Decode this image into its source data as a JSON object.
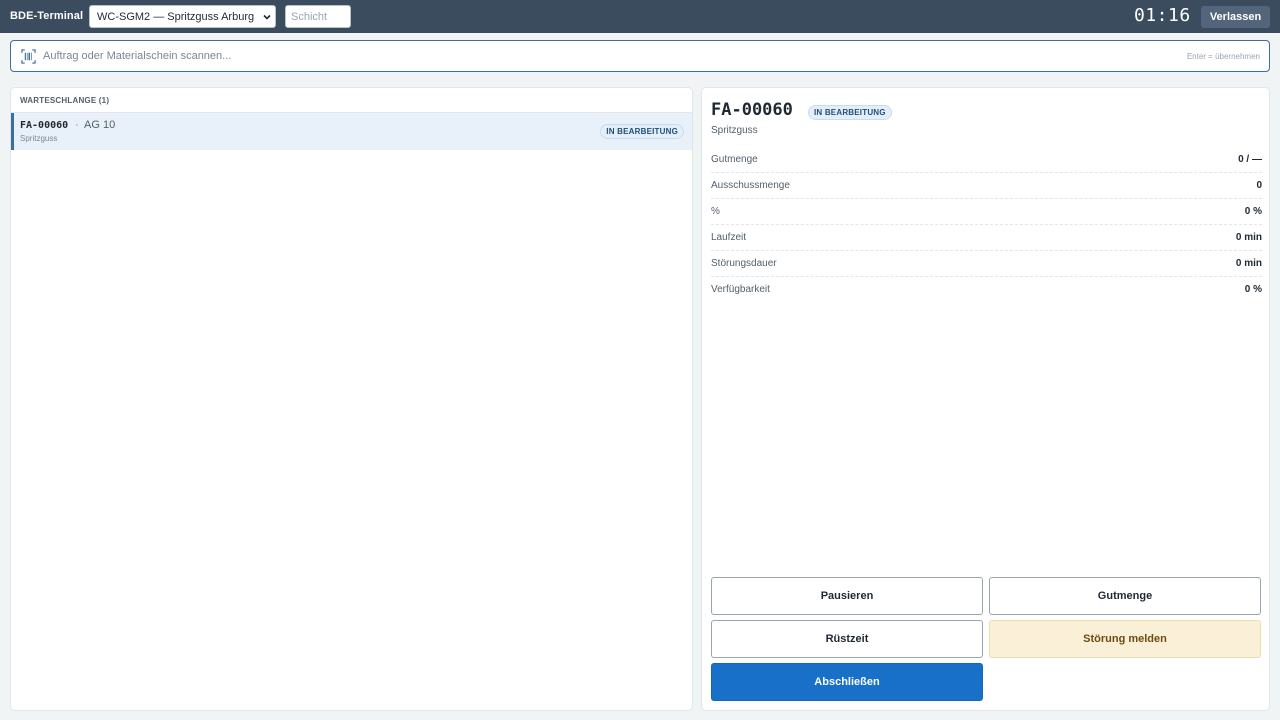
{
  "header": {
    "app_title": "BDE-Terminal",
    "workcenter_selected": "WC-SGM2 — Spritzguss Arburg",
    "shift_placeholder": "Schicht",
    "clock": "01:16",
    "leave_label": "Verlassen"
  },
  "scan": {
    "placeholder": "Auftrag oder Materialschein scannen...",
    "hint": "Enter = übernehmen",
    "icon": "barcode-icon"
  },
  "queue": {
    "title": "WARTESCHLANGE (1)",
    "items": [
      {
        "order": "FA-00060",
        "separator": "·",
        "step": "AG 10",
        "subtitle": "Spritzguss",
        "status": "IN BEARBEITUNG"
      }
    ]
  },
  "detail": {
    "order": "FA-00060",
    "status": "IN BEARBEITUNG",
    "subtitle": "Spritzguss",
    "metrics": [
      {
        "label": "Gutmenge",
        "value": "0 / —"
      },
      {
        "label": "Ausschussmenge",
        "value": "0"
      },
      {
        "label": "%",
        "value": "0 %"
      },
      {
        "label": "Laufzeit",
        "value": "0 min"
      },
      {
        "label": "Störungsdauer",
        "value": "0 min"
      },
      {
        "label": "Verfügbarkeit",
        "value": "0 %"
      }
    ]
  },
  "actions": {
    "pause": "Pausieren",
    "good_qty": "Gutmenge",
    "setup": "Rüstzeit",
    "report_fault": "Störung melden",
    "complete": "Abschließen"
  },
  "colors": {
    "header_bg": "#3a4c5e",
    "primary": "#1870c9",
    "warn_bg": "#faf0d8",
    "badge_bg": "#e3eef8",
    "selected_row": "#e8f1f9"
  }
}
